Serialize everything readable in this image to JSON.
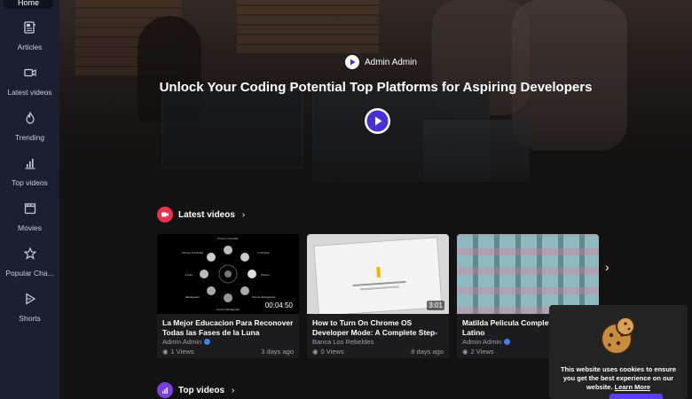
{
  "sidebar": {
    "home_label": "Home",
    "items": [
      {
        "label": "Articles",
        "icon": "articles-icon"
      },
      {
        "label": "Latest videos",
        "icon": "video-camera-icon"
      },
      {
        "label": "Trending",
        "icon": "flame-icon"
      },
      {
        "label": "Top videos",
        "icon": "bar-chart-icon"
      },
      {
        "label": "Movies",
        "icon": "clapperboard-icon"
      },
      {
        "label": "Popular Cha...",
        "icon": "star-icon"
      },
      {
        "label": "Shorts",
        "icon": "shorts-play-icon"
      }
    ]
  },
  "hero": {
    "author": "Admin Admin",
    "title": "Unlock Your Coding Potential Top Platforms for Aspiring Developers"
  },
  "latest_section": {
    "title": "Latest videos",
    "icon_color": "#e8304f"
  },
  "top_section": {
    "title": "Top videos",
    "icon_color": "#7b3fe0"
  },
  "latest_videos": [
    {
      "title": "La Mejor Educacion Para Reconover Todas las Fases de la Luna",
      "duration": "00:04:50",
      "author": "Admin Admin",
      "verified": true,
      "views": "1 Views",
      "date": "3 days ago",
      "moon_labels": [
        "Cuarto Creciente",
        "Gibosa Creciente",
        "Creciente",
        "Llena",
        "Nueva",
        "Menguante",
        "Gibosa Menguante",
        "Cuarto Menguante"
      ]
    },
    {
      "title": "How to Turn On Chrome OS Developer Mode: A Complete Step-by-Step...",
      "duration": "3:01",
      "author": "Banca Los Rebeldes",
      "verified": false,
      "views": "0 Views",
      "date": "8 days ago"
    },
    {
      "title": "Matilda Pelicula Complet Español Latino",
      "duration": "",
      "author": "Admin Admin",
      "verified": true,
      "views": "2 Views",
      "date": ""
    }
  ],
  "cookie": {
    "text": "This website uses cookies to ensure you get the best experience on our website.",
    "link": "Learn More"
  },
  "accent": "#4b2fd6"
}
